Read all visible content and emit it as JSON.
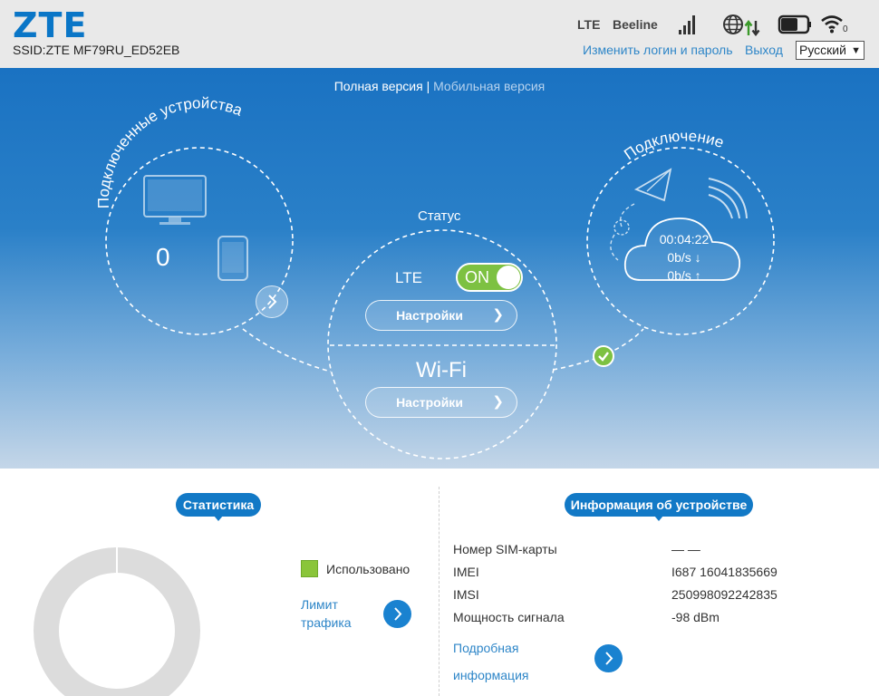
{
  "header": {
    "logo": "ZTE",
    "ssid": "SSID:ZTE MF79RU_ED52EB",
    "network_type": "LTE",
    "operator": "Beeline",
    "wifi_clients": "0",
    "change_login": "Изменить логин и пароль",
    "logout": "Выход",
    "language": "Русский",
    "icons": [
      "signal-icon",
      "globe-transfer-icon",
      "battery-icon",
      "wifi-icon"
    ]
  },
  "hero": {
    "version_full": "Полная версия",
    "version_sep": "|",
    "version_mobile": "Мобильная версия",
    "devices": {
      "title": "Подключенные устройства",
      "count": "0"
    },
    "status": {
      "title": "Статус",
      "lte_label": "LTE",
      "lte_toggle": "ON",
      "lte_settings": "Настройки",
      "wifi_label": "Wi-Fi",
      "wifi_settings": "Настройки"
    },
    "connection": {
      "title": "Подключение",
      "time": "00:04:22",
      "down": "0b/s ↓",
      "up": "0b/s ↑"
    }
  },
  "statistics": {
    "title": "Статистика",
    "legend_used": "Использовано",
    "limit_link": "Лимит трафика"
  },
  "device_info": {
    "title": "Информация об устройстве",
    "rows": [
      {
        "label": "Номер SIM-карты",
        "value": "— —"
      },
      {
        "label": "IMEI",
        "value": "Ι687 16041835669"
      },
      {
        "label": "IMSI",
        "value": "250998092242835"
      },
      {
        "label": "Мощность сигнала",
        "value": "-98 dBm"
      }
    ],
    "detail_link": "Подробная информация"
  },
  "colors": {
    "brand": "#0a76c7",
    "accent_green": "#7dc142",
    "link": "#2e86c8"
  }
}
